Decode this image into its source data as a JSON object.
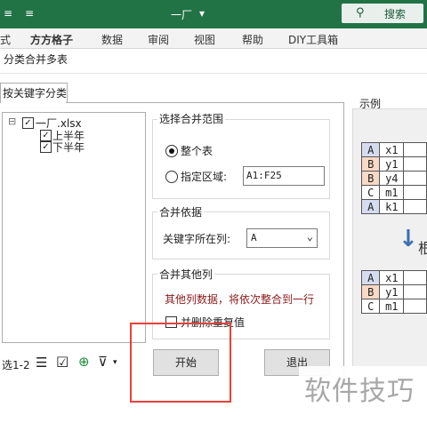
{
  "titlebar": {
    "app_icon": "≡",
    "caret": "≡",
    "doc_title": "一厂",
    "doc_caret": "▾",
    "search_label": "搜索",
    "search_icon": "search-icon"
  },
  "ribbon": {
    "tabs": [
      "式",
      "方方格子",
      "数据",
      "审阅",
      "视图",
      "帮助",
      "DIY工具箱"
    ]
  },
  "dialog": {
    "title": "分类合并多表",
    "tab_label": "按关键字分类",
    "tree": {
      "collapse_glyph": "⊟",
      "root": "一厂.xlsx",
      "children": [
        "上半年",
        "下半年"
      ],
      "check_glyph": "✓"
    },
    "range_group": {
      "title": "选择合并范围",
      "whole_sheet": "整个表",
      "specify_range": "指定区域:",
      "range_value": "A1:F25",
      "selected": "whole_sheet"
    },
    "basis_group": {
      "title": "合并依据",
      "key_column_label": "关键字所在列:",
      "key_column_value": "A",
      "dropdown_glyph": "⌵"
    },
    "other_group": {
      "title": "合并其他列",
      "note": "其他列数据，将依次整合到一行",
      "note_color": "#8b1a1a",
      "dedupe_label": "并删除重复值",
      "dedupe_checked": false
    },
    "bottom": {
      "selection_count": "选1-2",
      "list_icon": "☰",
      "check_icon": "☑",
      "add_icon": "⊕",
      "filter_icon": "⊽"
    },
    "start_button": "开始",
    "exit_button": "退出"
  },
  "example": {
    "label": "示例",
    "arrow_glyph": "↓",
    "side_text": "根",
    "table_before": [
      [
        "A",
        "x1"
      ],
      [
        "B",
        "y1"
      ],
      [
        "B",
        "y4"
      ],
      [
        "C",
        "m1"
      ],
      [
        "A",
        "k1"
      ]
    ],
    "table_after": [
      [
        "A",
        "x1"
      ],
      [
        "B",
        "y1"
      ],
      [
        "C",
        "m1"
      ]
    ],
    "colors": {
      "A": "#d6dcef",
      "B": "#f8d9c6",
      "C": "#ffffff"
    }
  },
  "watermark": "软件技巧"
}
